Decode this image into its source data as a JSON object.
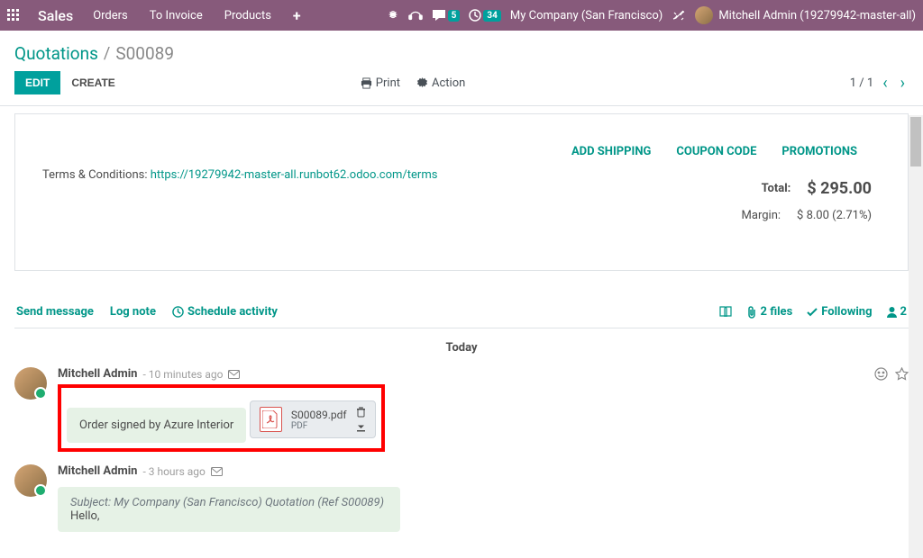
{
  "navbar": {
    "brand": "Sales",
    "items": [
      "Orders",
      "To Invoice",
      "Products"
    ],
    "chat_badge": "5",
    "activity_badge": "34",
    "company": "My Company (San Francisco)",
    "user": "Mitchell Admin (19279942-master-all)"
  },
  "breadcrumb": {
    "root": "Quotations",
    "current": "S00089"
  },
  "controls": {
    "edit": "EDIT",
    "create": "CREATE",
    "print": "Print",
    "action": "Action",
    "pager": "1 / 1"
  },
  "form": {
    "terms_label": "Terms & Conditions: ",
    "terms_link": "https://19279942-master-all.runbot62.odoo.com/terms",
    "add_shipping": "ADD SHIPPING",
    "coupon": "COUPON CODE",
    "promotions": "PROMOTIONS",
    "total_label": "Total:",
    "total_value": "$ 295.00",
    "margin_label": "Margin:",
    "margin_value": "$ 8.00 (2.71%)"
  },
  "chatter": {
    "send": "Send message",
    "log": "Log note",
    "schedule": "Schedule activity",
    "files": "2 files",
    "following": "Following",
    "followers": "2",
    "today": "Today"
  },
  "messages": [
    {
      "author": "Mitchell Admin",
      "time": "- 10 minutes ago",
      "note": "Order signed by Azure Interior",
      "attachment_name": "S00089.pdf",
      "attachment_type": "PDF"
    },
    {
      "author": "Mitchell Admin",
      "time": "- 3 hours ago",
      "subject": "Subject: My Company (San Francisco) Quotation (Ref S00089)",
      "body": "Hello,"
    }
  ]
}
